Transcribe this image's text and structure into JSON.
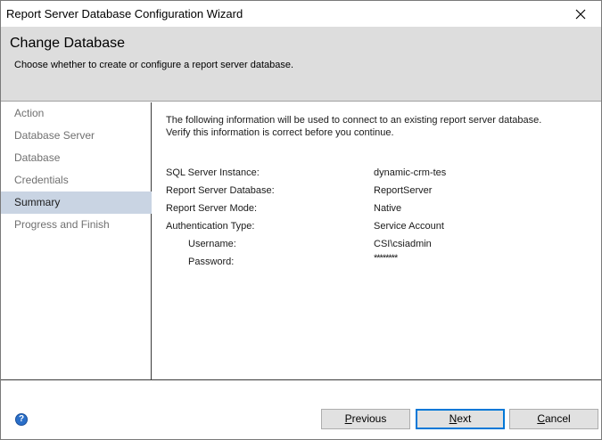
{
  "window": {
    "title": "Report Server Database Configuration Wizard"
  },
  "header": {
    "title": "Change Database",
    "subtitle": "Choose whether to create or configure a report server database."
  },
  "sidebar": {
    "steps": [
      {
        "label": "Action",
        "active": false
      },
      {
        "label": "Database Server",
        "active": false
      },
      {
        "label": "Database",
        "active": false
      },
      {
        "label": "Credentials",
        "active": false
      },
      {
        "label": "Summary",
        "active": true
      },
      {
        "label": "Progress and Finish",
        "active": false
      }
    ]
  },
  "summary": {
    "intro_line1": "The following information will be used to connect to an existing report server database.",
    "intro_line2": "Verify this information is correct before you continue.",
    "rows": [
      {
        "label": "SQL Server Instance:",
        "value": "dynamic-crm-tes"
      },
      {
        "label": "Report Server Database:",
        "value": "ReportServer"
      },
      {
        "label": "Report Server Mode:",
        "value": "Native"
      },
      {
        "label": "Authentication Type:",
        "value": "Service Account"
      },
      {
        "label": "Username:",
        "value": "CSI\\csiadmin"
      },
      {
        "label": "Password:",
        "value": "********"
      }
    ]
  },
  "buttons": {
    "previous": {
      "prefix": "",
      "accel": "P",
      "rest": "revious"
    },
    "next": {
      "prefix": "",
      "accel": "N",
      "rest": "ext"
    },
    "cancel": {
      "prefix": "",
      "accel": "C",
      "rest": "ancel"
    }
  },
  "icons": {
    "close": "close-icon",
    "help": "help-icon"
  },
  "colors": {
    "header_bg": "#dddddd",
    "active_step_bg": "#c9d4e3",
    "primary_border": "#0078d7"
  }
}
